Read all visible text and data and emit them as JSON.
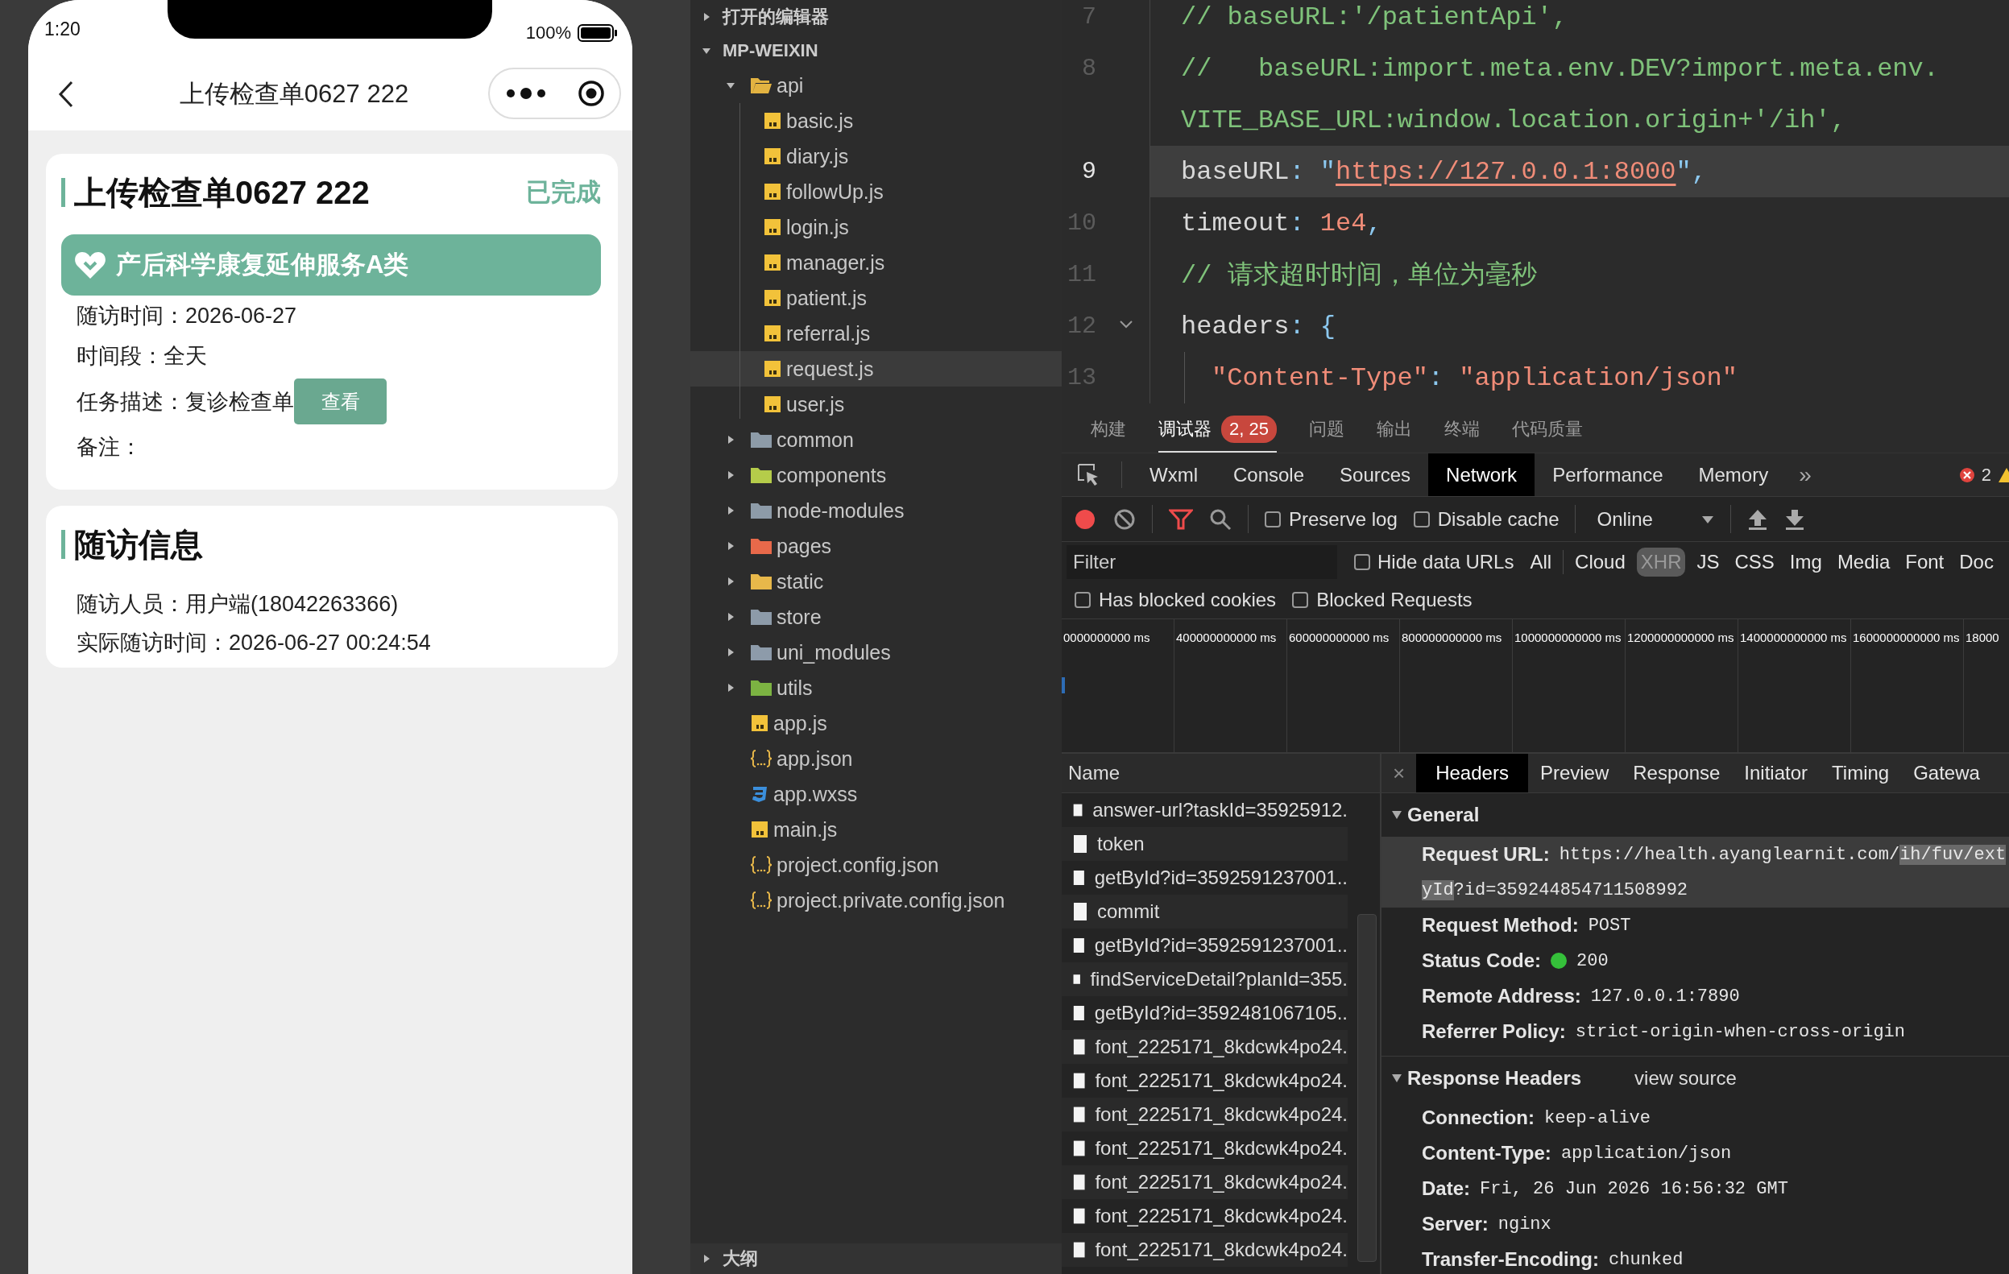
{
  "phone": {
    "status_bar": {
      "time": "1:20",
      "battery": "100%"
    },
    "nav": {
      "title": "上传检查单0627 222"
    },
    "task_card": {
      "title": "上传检查单0627 222",
      "status": "已完成",
      "banner": "产后科学康复延伸服务A类",
      "fields": [
        {
          "text": "随访时间：2026-06-27"
        },
        {
          "text": "时间段：全天"
        },
        {
          "text": "任务描述：复诊检查单",
          "action": "查看"
        },
        {
          "text": "备注："
        }
      ]
    },
    "followup_card": {
      "title": "随访信息",
      "fields": [
        {
          "text": "随访人员：用户端(18042263366)"
        },
        {
          "text": "实际随访时间：2026-06-27 00:24:54"
        }
      ]
    }
  },
  "explorer": {
    "sections": [
      {
        "label": "打开的编辑器",
        "expanded": false
      },
      {
        "label": "MP-WEIXIN",
        "expanded": true,
        "items": [
          {
            "name": "api",
            "kind": "folder",
            "color": "#e3b341",
            "expanded": true,
            "selected": false,
            "children": [
              {
                "name": "basic.js",
                "kind": "js",
                "selected": false
              },
              {
                "name": "diary.js",
                "kind": "js",
                "selected": false
              },
              {
                "name": "followUp.js",
                "kind": "js",
                "selected": false
              },
              {
                "name": "login.js",
                "kind": "js",
                "selected": false
              },
              {
                "name": "manager.js",
                "kind": "js",
                "selected": false
              },
              {
                "name": "patient.js",
                "kind": "js",
                "selected": false
              },
              {
                "name": "referral.js",
                "kind": "js",
                "selected": false
              },
              {
                "name": "request.js",
                "kind": "js",
                "selected": true
              },
              {
                "name": "user.js",
                "kind": "js",
                "selected": false
              }
            ]
          },
          {
            "name": "common",
            "kind": "folder",
            "color": "#8d9ba8",
            "expanded": false,
            "selected": false
          },
          {
            "name": "components",
            "kind": "folder",
            "color": "#b5cc4a",
            "expanded": false,
            "selected": false
          },
          {
            "name": "node-modules",
            "kind": "folder",
            "color": "#8d9ba8",
            "expanded": false,
            "selected": false
          },
          {
            "name": "pages",
            "kind": "folder",
            "color": "#e8694a",
            "expanded": false,
            "selected": false
          },
          {
            "name": "static",
            "kind": "folder",
            "color": "#e8b84a",
            "expanded": false,
            "selected": false
          },
          {
            "name": "store",
            "kind": "folder",
            "color": "#8d9ba9",
            "expanded": false,
            "selected": false
          },
          {
            "name": "uni_modules",
            "kind": "folder",
            "color": "#8d9baa",
            "expanded": false,
            "selected": false
          },
          {
            "name": "utils",
            "kind": "folder",
            "color": "#7cb342",
            "expanded": false,
            "selected": false
          },
          {
            "name": "app.js",
            "kind": "js",
            "selected": false
          },
          {
            "name": "app.json",
            "kind": "json",
            "selected": false
          },
          {
            "name": "app.wxss",
            "kind": "css",
            "selected": false
          },
          {
            "name": "main.js",
            "kind": "js",
            "selected": false
          },
          {
            "name": "project.config.json",
            "kind": "json",
            "selected": false
          },
          {
            "name": "project.private.config.json",
            "kind": "json",
            "selected": false
          }
        ]
      }
    ],
    "outline": {
      "label": "大纲",
      "expanded": false
    }
  },
  "editor": {
    "lines": [
      {
        "number": "7",
        "current": false,
        "tokens": [
          {
            "kind": "comment",
            "text": "// baseURL:'/patientApi',"
          }
        ]
      },
      {
        "number": "8",
        "current": false,
        "tokens": [
          {
            "kind": "comment",
            "text": "//   baseURL:import.meta.env.DEV?import.meta.env."
          }
        ]
      },
      {
        "current": false,
        "tokens": [
          {
            "kind": "comment",
            "text": "VITE_BASE_URL:window.location.origin+'/ih',"
          }
        ]
      },
      {
        "number": "9",
        "current": true,
        "tokens": [
          {
            "kind": "key",
            "text": "baseURL"
          },
          {
            "kind": "punct",
            "text": ": \""
          },
          {
            "kind": "link",
            "text": "https://127.0.0.1:8000"
          },
          {
            "kind": "punct",
            "text": "\","
          }
        ]
      },
      {
        "number": "10",
        "current": false,
        "tokens": [
          {
            "kind": "key",
            "text": "timeout"
          },
          {
            "kind": "punct",
            "text": ": "
          },
          {
            "kind": "number",
            "text": "1e4"
          },
          {
            "kind": "punct",
            "text": ","
          }
        ]
      },
      {
        "number": "11",
        "current": false,
        "tokens": [
          {
            "kind": "comment",
            "text": "// 请求超时时间，单位为毫秒"
          }
        ]
      },
      {
        "number": "12",
        "current": false,
        "expanded": true,
        "tokens": [
          {
            "kind": "key",
            "text": "headers"
          },
          {
            "kind": "punct",
            "text": ": {"
          }
        ],
        "children": [
          {
            "number": "13",
            "current": false,
            "tokens": [
              {
                "kind": "string",
                "text": "\"Content-Type\""
              },
              {
                "kind": "punct",
                "text": ": "
              },
              {
                "kind": "string",
                "text": "\"application/json\""
              }
            ]
          }
        ]
      }
    ]
  },
  "devtools": {
    "drawer_tabs": [
      {
        "label": "构建",
        "selected": false
      },
      {
        "label": "调试器",
        "selected": true,
        "badge": "2, 25"
      },
      {
        "label": "问题",
        "selected": false
      },
      {
        "label": "输出",
        "selected": false
      },
      {
        "label": "终端",
        "selected": false
      },
      {
        "label": "代码质量",
        "selected": false
      }
    ],
    "panel_tabs": [
      {
        "label": "Wxml",
        "selected": false
      },
      {
        "label": "Console",
        "selected": false
      },
      {
        "label": "Sources",
        "selected": false
      },
      {
        "label": "Network",
        "selected": true
      },
      {
        "label": "Performance",
        "selected": false
      },
      {
        "label": "Memory",
        "selected": false
      }
    ],
    "more": "»",
    "error_count": "2",
    "toolbar": {
      "recording": true,
      "filter_active": true,
      "checkboxes": [
        {
          "label": "Preserve log",
          "checked": false
        },
        {
          "label": "Disable cache",
          "checked": false
        }
      ],
      "throttling": "Online"
    },
    "filter": {
      "placeholder": "Filter",
      "checkbox": {
        "label": "Hide data URLs",
        "checked": false
      },
      "types": [
        {
          "label": "All",
          "selected": false
        },
        {
          "label": "Cloud",
          "selected": false
        },
        {
          "label": "XHR",
          "selected": true
        },
        {
          "label": "JS",
          "selected": false
        },
        {
          "label": "CSS",
          "selected": false
        },
        {
          "label": "Img",
          "selected": false
        },
        {
          "label": "Media",
          "selected": false
        },
        {
          "label": "Font",
          "selected": false
        },
        {
          "label": "Doc",
          "selected": false
        }
      ],
      "checkboxes": [
        {
          "label": "Has blocked cookies",
          "checked": false
        },
        {
          "label": "Blocked Requests",
          "checked": false
        }
      ]
    },
    "timeline": {
      "ticks": [
        "0000000000 ms",
        "400000000000 ms",
        "600000000000 ms",
        "800000000000 ms",
        "1000000000000 ms",
        "1200000000000 ms",
        "1400000000000 ms",
        "1600000000000 ms",
        "18000"
      ]
    },
    "requests": {
      "column": "Name",
      "rows": [
        {
          "name": "answer-url?taskId=35925912.",
          "selected": false
        },
        {
          "name": "token",
          "selected": false
        },
        {
          "name": "getById?id=3592591237001..",
          "selected": false
        },
        {
          "name": "commit",
          "selected": false
        },
        {
          "name": "getById?id=3592591237001..",
          "selected": false
        },
        {
          "name": "findServiceDetail?planId=355.",
          "selected": false
        },
        {
          "name": "getById?id=3592481067105..",
          "selected": false
        },
        {
          "name": "font_2225171_8kdcwk4po24.",
          "selected": false
        },
        {
          "name": "font_2225171_8kdcwk4po24.",
          "selected": false
        },
        {
          "name": "font_2225171_8kdcwk4po24.",
          "selected": false
        },
        {
          "name": "font_2225171_8kdcwk4po24.",
          "selected": false
        },
        {
          "name": "font_2225171_8kdcwk4po24.",
          "selected": false
        },
        {
          "name": "font_2225171_8kdcwk4po24.",
          "selected": false
        },
        {
          "name": "font_2225171_8kdcwk4po24.",
          "selected": false
        }
      ]
    },
    "details": {
      "close": "×",
      "tabs": [
        {
          "label": "Headers",
          "selected": true
        },
        {
          "label": "Preview",
          "selected": false
        },
        {
          "label": "Response",
          "selected": false
        },
        {
          "label": "Initiator",
          "selected": false
        },
        {
          "label": "Timing",
          "selected": false
        },
        {
          "label": "Gatewa",
          "selected": false
        }
      ],
      "general": {
        "title": "General",
        "expanded": true,
        "rows": [
          {
            "kind": "url",
            "key": "Request URL:",
            "selected": true,
            "value_lines": [
              [
                {
                  "text": "https://health.ayanglearnit.com/",
                  "selected": false
                },
                {
                  "text": "ih/fuv/ext",
                  "selected": true
                }
              ],
              [
                {
                  "text": "yId",
                  "selected": true
                },
                {
                  "text": "?id=359244854711508992",
                  "selected": false
                }
              ]
            ]
          },
          {
            "kind": "text",
            "key": "Request Method:",
            "value": "POST",
            "selected": false
          },
          {
            "kind": "status",
            "key": "Status Code:",
            "value": "200",
            "color": "#35c03a",
            "selected": false
          },
          {
            "kind": "text",
            "key": "Remote Address:",
            "value": "127.0.0.1:7890",
            "selected": false
          },
          {
            "kind": "text",
            "key": "Referrer Policy:",
            "value": "strict-origin-when-cross-origin",
            "selected": false
          }
        ]
      },
      "response_headers": {
        "title": "Response Headers",
        "expanded": true,
        "link": "view source",
        "rows": [
          {
            "key": "Connection:",
            "value": "keep-alive"
          },
          {
            "key": "Content-Type:",
            "value": "application/json"
          },
          {
            "key": "Date:",
            "value": "Fri, 26 Jun 2026 16:56:32 GMT"
          },
          {
            "key": "Server:",
            "value": "nginx"
          },
          {
            "key": "Transfer-Encoding:",
            "value": "chunked"
          }
        ]
      }
    }
  }
}
